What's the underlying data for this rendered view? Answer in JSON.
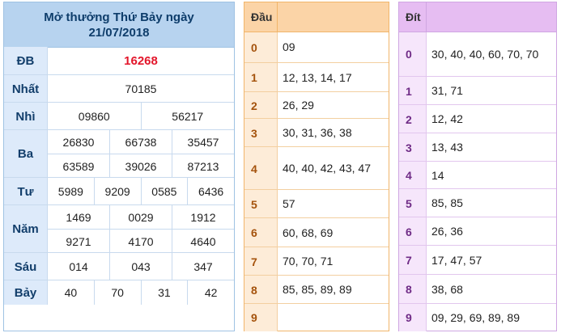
{
  "results": {
    "title_line1": "Mở thưởng Thứ Bảy ngày",
    "title_line2": "21/07/2018",
    "prizes": [
      {
        "label": "ĐB",
        "rows": [
          [
            "16268"
          ]
        ],
        "special": true
      },
      {
        "label": "Nhất",
        "rows": [
          [
            "70185"
          ]
        ]
      },
      {
        "label": "Nhì",
        "rows": [
          [
            "09860",
            "56217"
          ]
        ]
      },
      {
        "label": "Ba",
        "rows": [
          [
            "26830",
            "66738",
            "35457"
          ],
          [
            "63589",
            "39026",
            "87213"
          ]
        ]
      },
      {
        "label": "Tư",
        "rows": [
          [
            "5989",
            "9209",
            "0585",
            "6436"
          ]
        ]
      },
      {
        "label": "Năm",
        "rows": [
          [
            "1469",
            "0029",
            "1912"
          ],
          [
            "9271",
            "4170",
            "4640"
          ]
        ]
      },
      {
        "label": "Sáu",
        "rows": [
          [
            "014",
            "043",
            "347"
          ]
        ]
      },
      {
        "label": "Bảy",
        "rows": [
          [
            "40",
            "70",
            "31",
            "42"
          ]
        ]
      }
    ]
  },
  "dau": {
    "header": "Đầu",
    "rows": [
      {
        "key": "0",
        "values": "09"
      },
      {
        "key": "1",
        "values": "12, 13, 14, 17"
      },
      {
        "key": "2",
        "values": "26, 29"
      },
      {
        "key": "3",
        "values": "30, 31, 36, 38"
      },
      {
        "key": "4",
        "values": "40, 40, 42, 43, 47"
      },
      {
        "key": "5",
        "values": "57"
      },
      {
        "key": "6",
        "values": "60, 68, 69"
      },
      {
        "key": "7",
        "values": "70, 70, 71"
      },
      {
        "key": "8",
        "values": "85, 85, 89, 89"
      },
      {
        "key": "9",
        "values": ""
      }
    ]
  },
  "dit": {
    "header": "Đít",
    "rows": [
      {
        "key": "0",
        "values": "30, 40, 40, 60, 70, 70"
      },
      {
        "key": "1",
        "values": "31, 71"
      },
      {
        "key": "2",
        "values": "12, 42"
      },
      {
        "key": "3",
        "values": "13, 43"
      },
      {
        "key": "4",
        "values": "14"
      },
      {
        "key": "5",
        "values": "85, 85"
      },
      {
        "key": "6",
        "values": "26, 36"
      },
      {
        "key": "7",
        "values": "17, 47, 57"
      },
      {
        "key": "8",
        "values": "38, 68"
      },
      {
        "key": "9",
        "values": "09, 29, 69, 89, 89"
      }
    ]
  }
}
